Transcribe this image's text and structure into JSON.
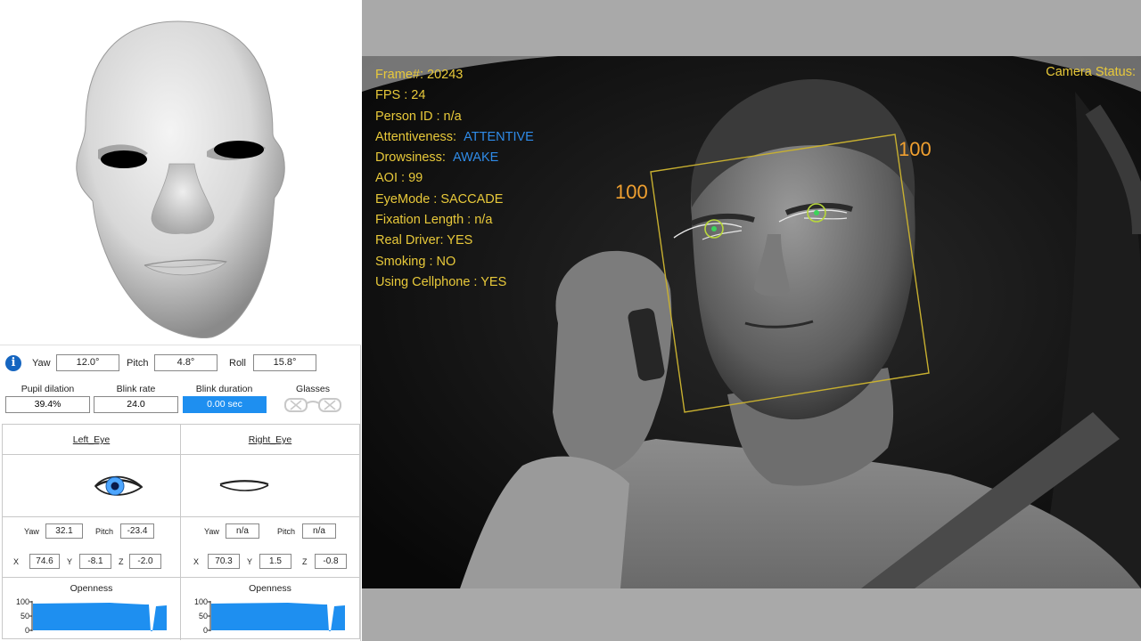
{
  "head_pose": {
    "yaw_label": "Yaw",
    "yaw_value": "12.0°",
    "pitch_label": "Pitch",
    "pitch_value": "4.8°",
    "roll_label": "Roll",
    "roll_value": "15.8°"
  },
  "metrics": {
    "pupil_dilation_label": "Pupil dilation",
    "pupil_dilation_value": "39.4%",
    "blink_rate_label": "Blink rate",
    "blink_rate_value": "24.0",
    "blink_duration_label": "Blink duration",
    "blink_duration_value": "0.00 sec",
    "glasses_label": "Glasses",
    "glasses_icon": "glasses-off-icon"
  },
  "left_eye": {
    "title": "Left_Eye",
    "state": "open",
    "yaw_label": "Yaw",
    "yaw_value": "32.1",
    "pitch_label": "Pitch",
    "pitch_value": "-23.4",
    "x_label": "X",
    "x_value": "74.6",
    "y_label": "Y",
    "y_value": "-8.1",
    "z_label": "Z",
    "z_value": "-2.0",
    "openness_title": "Openness",
    "openness_ticks": [
      "100",
      "50",
      "0"
    ],
    "openness_percent": 95
  },
  "right_eye": {
    "title": "Right_Eye",
    "state": "closed",
    "yaw_label": "Yaw",
    "yaw_value": "n/a",
    "pitch_label": "Pitch",
    "pitch_value": "n/a",
    "x_label": "X",
    "x_value": "70.3",
    "y_label": "Y",
    "y_value": "1.5",
    "z_label": "Z",
    "z_value": "-0.8",
    "openness_title": "Openness",
    "openness_ticks": [
      "100",
      "50",
      "0"
    ],
    "openness_percent": 95
  },
  "camera": {
    "frame": "Frame#:  20243",
    "fps": "FPS : 24",
    "person_id": "Person ID : n/a",
    "attentiveness_label": "Attentiveness:",
    "attentiveness_value": "ATTENTIVE",
    "drowsiness_label": "Drowsiness:",
    "drowsiness_value": "AWAKE",
    "aoi": "AOI : 99",
    "eye_mode": "EyeMode : SACCADE",
    "fixation": "Fixation Length : n/a",
    "real_driver": "Real Driver: YES",
    "smoking": "Smoking : NO",
    "cellphone": "Using Cellphone : YES",
    "camera_status": "Camera Status:",
    "box_label_left": "100",
    "box_label_right": "100"
  },
  "colors": {
    "overlay_yellow": "#e8c93a",
    "overlay_blue": "#2f8be8",
    "box_orange": "#f0a030",
    "accent_blue": "#1e8ff0"
  }
}
